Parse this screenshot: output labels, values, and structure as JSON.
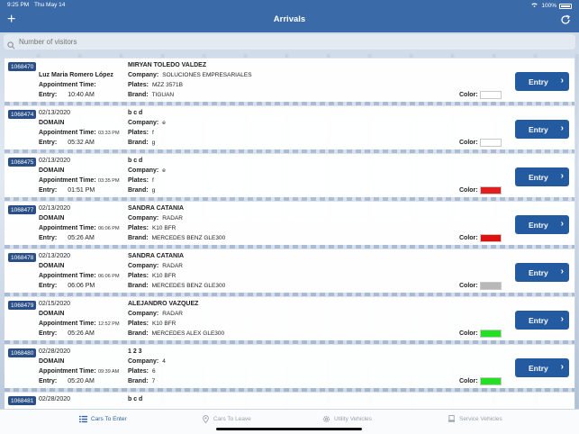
{
  "status": {
    "time": "9:25 PM",
    "date": "Thu May 14",
    "battery": "100%"
  },
  "nav": {
    "title": "Arrivals",
    "add_icon": "plus-icon",
    "refresh_icon": "refresh-icon"
  },
  "search": {
    "placeholder": "Number of visitors"
  },
  "labels": {
    "appointment_time": "Appointment Time:",
    "entry": "Entry:",
    "company": "Company:",
    "plates": "Plates:",
    "brand": "Brand:",
    "color": "Color:",
    "entry_button": "Entry"
  },
  "arrivals": [
    {
      "id": "1068470",
      "date": "",
      "name": "Luz Maria Romero López",
      "appointment_time": "",
      "entry_time": "10:40 AM",
      "visitor": "MIRYAN TOLEDO VALDEZ",
      "company": "SOLUCIONES EMPRESARIALES",
      "plates": "MZZ 3571B",
      "brand": "TIGUAN",
      "color": "#ffffff"
    },
    {
      "id": "1068474",
      "date": "02/13/2020",
      "name": "DOMAIN",
      "appointment_time": "03:33 PM",
      "entry_time": "05:32 AM",
      "visitor": "b c d",
      "company": "e",
      "plates": "f",
      "brand": "g",
      "color": "#ffffff"
    },
    {
      "id": "1068475",
      "date": "02/13/2020",
      "name": "DOMAIN",
      "appointment_time": "03:35 PM",
      "entry_time": "01:51 PM",
      "visitor": "b c d",
      "company": "e",
      "plates": "f",
      "brand": "g",
      "color": "#e02020"
    },
    {
      "id": "1068477",
      "date": "02/13/2020",
      "name": "DOMAIN",
      "appointment_time": "06:06 PM",
      "entry_time": "05:26 AM",
      "visitor": "SANDRA CATANIA",
      "company": "RADAR",
      "plates": "K10 BFR",
      "brand": "MERCEDES BENZ GLE300",
      "color": "#e01010"
    },
    {
      "id": "1068478",
      "date": "02/13/2020",
      "name": "DOMAIN",
      "appointment_time": "06:06 PM",
      "entry_time": "06:06 PM",
      "visitor": "SANDRA CATANIA",
      "company": "RADAR",
      "plates": "K10 BFR",
      "brand": "MERCEDES BENZ GLE300",
      "color": "#b8b8b8"
    },
    {
      "id": "1068479",
      "date": "02/15/2020",
      "name": "DOMAIN",
      "appointment_time": "12:52 PM",
      "entry_time": "05:26 AM",
      "visitor": "ALEJANDRO VAZQUEZ",
      "company": "RADAR",
      "plates": "K10 BFR",
      "brand": "MERCEDES ALEX GLE300",
      "color": "#22e022"
    },
    {
      "id": "1068480",
      "date": "02/28/2020",
      "name": "DOMAIN",
      "appointment_time": "09:39 AM",
      "entry_time": "05:20 AM",
      "visitor": "1 2 3",
      "company": "4",
      "plates": "6",
      "brand": "7",
      "color": "#22e022"
    },
    {
      "id": "1068481",
      "date": "02/28/2020",
      "name": "",
      "appointment_time": "",
      "entry_time": "",
      "visitor": "b c d",
      "company": "",
      "plates": "",
      "brand": "",
      "color": ""
    }
  ],
  "tabs": [
    {
      "label": "Cars To Enter",
      "icon": "list-icon",
      "active": true
    },
    {
      "label": "Cars To Leave",
      "icon": "location-pin-icon",
      "active": false
    },
    {
      "label": "Utility Vehicles",
      "icon": "gear-icon",
      "active": false
    },
    {
      "label": "Service Vehicles",
      "icon": "truck-icon",
      "active": false
    }
  ]
}
